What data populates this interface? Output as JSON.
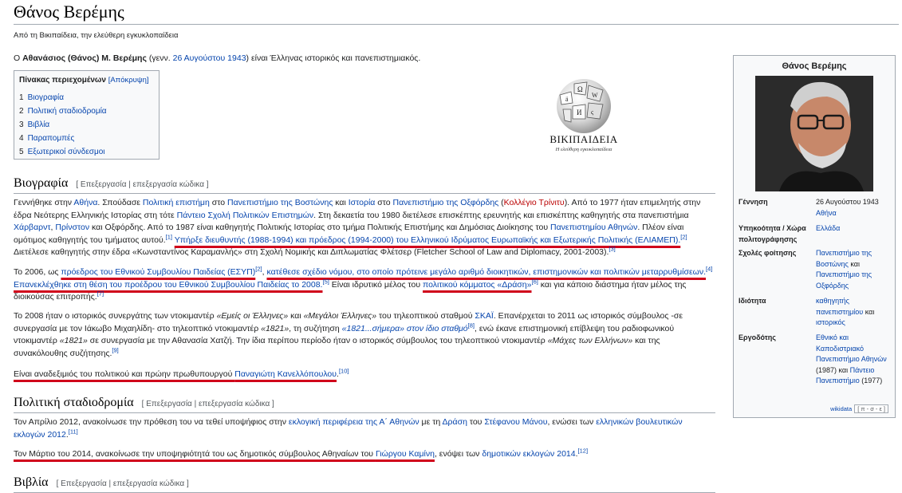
{
  "page": {
    "title": "Θάνος Βερέμης",
    "from_line": "Από τη Βικιπαίδεια, την ελεύθερη εγκυκλοπαίδεια"
  },
  "intro": {
    "pre": "Ο ",
    "bold": "Αθανάσιος (Θάνος) Μ. Βερέμης",
    "mid": " (γενν. ",
    "link": "26 Αυγούστου 1943",
    "post": ") είναι Έλληνας ιστορικός και πανεπιστημιακός."
  },
  "toc": {
    "heading": "Πίνακας περιεχομένων",
    "toggle": "[Απόκρυψη]",
    "items": [
      {
        "num": "1",
        "label": "Βιογραφία"
      },
      {
        "num": "2",
        "label": "Πολιτική σταδιοδρομία"
      },
      {
        "num": "3",
        "label": "Βιβλία"
      },
      {
        "num": "4",
        "label": "Παραπομπές"
      },
      {
        "num": "5",
        "label": "Εξωτερικοί σύνδεσμοι"
      }
    ]
  },
  "logo": {
    "wordmark": "ΒΙΚΙΠΑΙΔΕΙΑ",
    "tagline": "Η ελεύθερη εγκυκλοπαίδεια"
  },
  "sections": {
    "bio": {
      "title": "Βιογραφία",
      "edit": "[ Επεξεργασία | επεξεργασία κώδικα ]"
    },
    "career": {
      "title": "Πολιτική σταδιοδρομία",
      "edit": "[ Επεξεργασία | επεξεργασία κώδικα ]"
    },
    "books": {
      "title": "Βιβλία",
      "edit": "[ Επεξεργασία | επεξεργασία κώδικα ]"
    }
  },
  "bio": {
    "p1": {
      "t1": "Γεννήθηκε στην ",
      "l1": "Αθήνα",
      "t2": ". Σπούδασε ",
      "l2": "Πολιτική επιστήμη",
      "t3": " στο ",
      "l3": "Πανεπιστήμιο της Βοστώνης",
      "t4": " και ",
      "l4": "Ιστορία",
      "t5": " στο ",
      "l5": "Πανεπιστήμιο της Οξφόρδης",
      "t6": " (",
      "l6": "Κολλέγιο Τρίνιτυ",
      "t7": "). Από το 1977 ήταν επιμελητής στην έδρα Νεότερης Ελληνικής Ιστορίας στη τότε ",
      "l7": "Πάντειο Σχολή Πολιτικών Επιστημών",
      "t8": ". Στη δεκαετία του 1980 διετέλεσε επισκέπτης ερευνητής και επισκέπτης καθηγητής στα πανεπιστήμια ",
      "l8": "Χάρβαρντ",
      "t9": ", ",
      "l9": "Πρίνστον",
      "t10": " και Οξφόρδης. Από το 1987 είναι καθηγητής Πολιτικής Ιστορίας στο τμήμα Πολιτικής Επιστήμης και Δημόσιας Διοίκησης του ",
      "l10": "Πανεπιστημίου Αθηνών",
      "t11": ". Πλέον είναι ομότιμος καθηγητής του τμήματος αυτού.",
      "r1": "[1]",
      "t12": " ",
      "u1": "Υπήρξε διευθυντής (1988-1994) και πρόεδρος (1994-2000) του Ελληνικού Ιδρύματος Ευρωπαϊκής και Εξωτερικής Πολιτικής (ΕΛΙΑΜΕΠ).",
      "r2": "[2]",
      "t13": " Διετέλεσε καθηγητής στην έδρα «Κωνσταντίνος Καραμανλής» στη Σχολή Νομικής και Διπλωματίας Φλέτσερ (Fletcher School of Law and Diplomacy, 2001-2003).",
      "r3": "[3]"
    },
    "p2": {
      "t1": "Το 2006, ως ",
      "u1": "πρόεδρος του Εθνικού Συμβουλίου Παιδείας (ΕΣΥΠ)",
      "r1": "[2]",
      "t2": ", ",
      "u2": "κατέθεσε σχέδιο νόμου, στο οποίο πρότεινε μεγάλο αριθμό διοικητικών, επιστημονικών και πολιτικών μεταρρυθμίσεων.",
      "r2": "[4]",
      "t3": " ",
      "u3": "Επανεκλέχθηκε στη θέση του προέδρου του Εθνικού Συμβουλίου Παιδείας το 2008.",
      "r3": "[5]",
      "t4": " Είναι ιδρυτικό μέλος του ",
      "u4": "πολιτικού κόμματος «Δράση»",
      "r4": "[6]",
      "t5": " και για κάποιο διάστημα ήταν μέλος της διοικούσας επιτροπής.",
      "r5": "[7]"
    },
    "p3": {
      "t1": "Το 2008 ήταν ο ιστορικός συνεργάτης των ντοκιμαντέρ ",
      "i1": "«Εμείς οι Έλληνες»",
      "t2": " και ",
      "i2": "«Μεγάλοι Έλληνες»",
      "t3": " του τηλεοπτικού σταθμού ",
      "l1": "ΣΚΑΪ",
      "t4": ". Επανέρχεται το 2011 ως ιστορικός σύμβουλος -σε συνεργασία με τον Ιάκωβο Μιχαηλίδη- στο τηλεοπτικό ντοκιμαντέρ ",
      "i3": "«1821»",
      "t5": ", τη συζήτηση ",
      "i4": "«1821...σήμερα» στον ίδιο σταθμό",
      "r1": "[8]",
      "t6": ", ενώ έκανε επιστημονική επίβλεψη του ραδιοφωνικού ντοκιμαντέρ ",
      "i5": "«1821»",
      "t7": " σε συνεργασία με την Αθανασία Χατζή. Την ίδια περίπου περίοδο ήταν ο ιστορικός σύμβουλος του τηλεοπτικού ντοκιμαντέρ ",
      "i6": "«Μάχες των Ελλήνων»",
      "t8": " και της συνακόλουθης συζήτησης.",
      "r2": "[9]"
    },
    "p4": {
      "u1": "Είναι αναδεξιμιός του πολιτικού και πρώην πρωθυπουργού ",
      "l1": "Παναγιώτη Κανελλόπουλου",
      "t1": ".",
      "r1": "[10]"
    }
  },
  "career": {
    "p1": {
      "t1": "Τον Απρίλιο 2012, ανακοίνωσε την πρόθεση του να τεθεί υποψήφιος στην ",
      "l1": "εκλογική περιφέρεια της Α΄ Αθηνών",
      "t2": " με τη ",
      "l2": "Δράση",
      "t3": " του ",
      "l3": "Στέφανου Μάνου",
      "t4": ", ενώσει των ",
      "l4": "ελληνικών βουλευτικών εκλογών 2012",
      "t5": ".",
      "r1": "[11]"
    },
    "p2": {
      "u1": "Τον Μάρτιο του 2014, ανακοίνωσε την υποψηφιότητά του ως δημοτικός σύμβουλος Αθηναίων του ",
      "l1": "Γιώργου Καμίνη",
      "t1": ", ενόψει των ",
      "l2": "δημοτικών εκλογών 2014",
      "t2": ".",
      "r1": "[12]"
    }
  },
  "infobox": {
    "title": "Θάνος Βερέμης",
    "rows": [
      {
        "label": "Γέννηση",
        "v1": "26 Αυγούστου 1943",
        "v2": "Αθήνα"
      },
      {
        "label": "Υπηκοότητα / Χώρα πολιτογράφησης",
        "v1": "Ελλάδα"
      },
      {
        "label": "Σχολές φοίτησης",
        "v1": "Πανεπιστήμιο της Βοστώνης",
        "v1b": " και ",
        "v2": "Πανεπιστήμιο της Οξφόρδης"
      },
      {
        "label": "Ιδιότητα",
        "v1": "καθηγητής πανεπιστημίου",
        "v1b": " και ",
        "v2": "ιστορικός"
      },
      {
        "label": "Εργοδότης",
        "v1": "Εθνικό και Καποδιστριακό Πανεπιστήμιο Αθηνών",
        "v1b": " (1987) και ",
        "v2": "Πάντειο Πανεπιστήμιο",
        "v2b": " (1977)"
      }
    ],
    "footer": "wikidata",
    "footer_box": "[ π - σ - ε ]"
  }
}
